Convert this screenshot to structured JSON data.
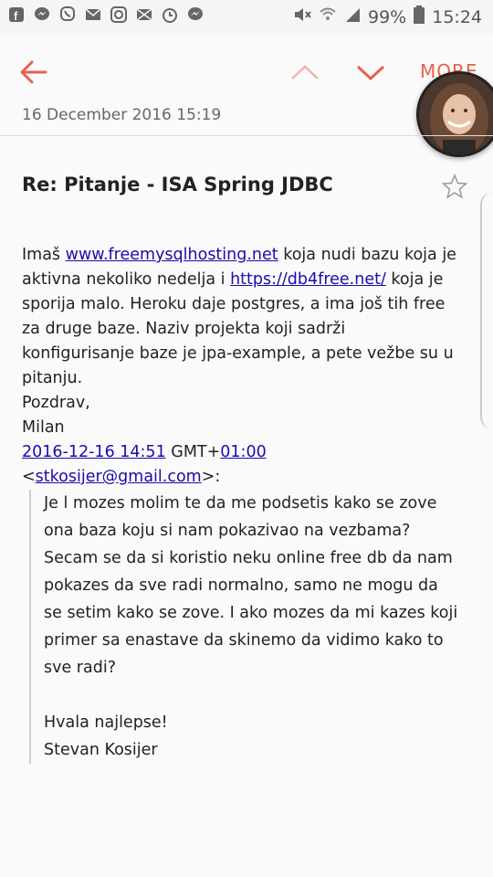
{
  "status_bar": {
    "battery": "99%",
    "time": "15:24",
    "left_icons": [
      "facebook-icon",
      "messenger-icon",
      "viber-icon",
      "email-icon",
      "instagram-icon",
      "mail-icon",
      "alarm-icon",
      "messenger-icon"
    ],
    "right_icons": [
      "mute-icon",
      "wifi-icon",
      "signal-icon",
      "battery-icon"
    ]
  },
  "app_bar": {
    "more_label": "MORE",
    "accent_color": "#e8604c"
  },
  "email": {
    "date": "16 December 2016  15:19",
    "subject": "Re: Pitanje - ISA Spring JDBC",
    "body": {
      "p1_a": "Imaš ",
      "link1": "www.freemysqlhosting.net",
      "p1_b": " koja nudi bazu koja je aktivna nekoliko nedelja i ",
      "link2": "https://db4free.net/",
      "p1_c": " koja je sporija malo. Heroku daje postgres, a ima još tih free za druge baze. Naziv projekta koji sadrži konfigurisanje baze je jpa-example, a pete vežbe su u pitanju.",
      "signoff": "Pozdrav,",
      "name": "Milan"
    },
    "quote_header": {
      "date_link": "2016-12-16 14:51",
      "gmt": " GMT+",
      "gmt_link": "01:00",
      "lt": "<",
      "email_link": "stkosijer@gmail.com",
      "gt": ">:"
    },
    "quoted": {
      "text": "Je l mozes molim te da me podsetis kako se zove ona baza koju si nam pokazivao na vezbama? Secam se da si koristio neku online free db da nam pokazes da sve radi normalno, samo ne mogu da se setim kako se zove. I ako mozes da mi kazes koji primer sa enastave da skinemo da vidimo kako to sve radi?",
      "thanks": "Hvala najlepse!",
      "sender": "Stevan Kosijer"
    }
  }
}
